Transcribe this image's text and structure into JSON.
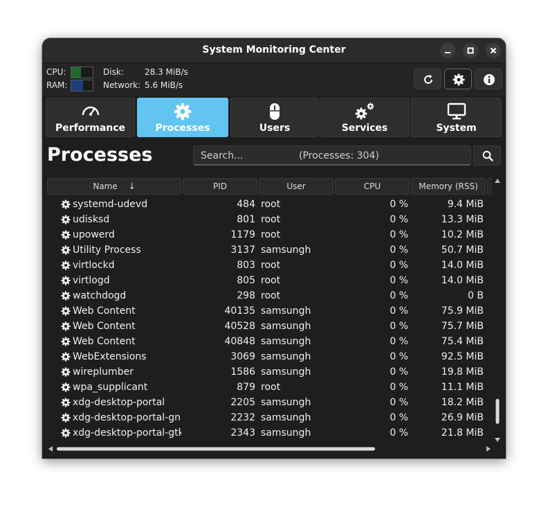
{
  "window": {
    "title": "System Monitoring Center"
  },
  "summary": {
    "cpu_label": "CPU:",
    "ram_label": "RAM:",
    "cpu_fraction": 0.45,
    "ram_fraction": 0.55,
    "disk_label": "Disk:",
    "disk_value": "28.3 MiB/s",
    "network_label": "Network:",
    "network_value": "5.6 MiB/s"
  },
  "colors": {
    "accent": "#62c4f0",
    "cpu_fill": "#1d6b2b",
    "ram_fill": "#1f3f7a"
  },
  "tabs": [
    {
      "label": "Performance",
      "icon": "speedometer-icon",
      "selected": false
    },
    {
      "label": "Processes",
      "icon": "gear-icon",
      "selected": true
    },
    {
      "label": "Users",
      "icon": "mouse-icon",
      "selected": false
    },
    {
      "label": "Services",
      "icon": "gears-icon",
      "selected": false
    },
    {
      "label": "System",
      "icon": "monitor-icon",
      "selected": false
    }
  ],
  "page": {
    "heading": "Processes"
  },
  "search": {
    "placeholder": "Search...",
    "count_text": "(Processes: 304)"
  },
  "table": {
    "columns": [
      "Name",
      "PID",
      "User",
      "CPU",
      "Memory (RSS)"
    ],
    "sort_indicator": "↓",
    "rows": [
      {
        "name": "systemd-udevd",
        "pid": "484",
        "user": "root",
        "cpu": "0 %",
        "mem": "9.4 MiB"
      },
      {
        "name": "udisksd",
        "pid": "801",
        "user": "root",
        "cpu": "0 %",
        "mem": "13.3 MiB"
      },
      {
        "name": "upowerd",
        "pid": "1179",
        "user": "root",
        "cpu": "0 %",
        "mem": "10.2 MiB"
      },
      {
        "name": "Utility Process",
        "pid": "3137",
        "user": "samsungh",
        "cpu": "0 %",
        "mem": "50.7 MiB"
      },
      {
        "name": "virtlockd",
        "pid": "803",
        "user": "root",
        "cpu": "0 %",
        "mem": "14.0 MiB"
      },
      {
        "name": "virtlogd",
        "pid": "805",
        "user": "root",
        "cpu": "0 %",
        "mem": "14.0 MiB"
      },
      {
        "name": "watchdogd",
        "pid": "298",
        "user": "root",
        "cpu": "0 %",
        "mem": "0 B"
      },
      {
        "name": "Web Content",
        "pid": "40135",
        "user": "samsungh",
        "cpu": "0 %",
        "mem": "75.9 MiB"
      },
      {
        "name": "Web Content",
        "pid": "40528",
        "user": "samsungh",
        "cpu": "0 %",
        "mem": "75.7 MiB"
      },
      {
        "name": "Web Content",
        "pid": "40848",
        "user": "samsungh",
        "cpu": "0 %",
        "mem": "75.4 MiB"
      },
      {
        "name": "WebExtensions",
        "pid": "3069",
        "user": "samsungh",
        "cpu": "0 %",
        "mem": "92.5 MiB"
      },
      {
        "name": "wireplumber",
        "pid": "1586",
        "user": "samsungh",
        "cpu": "0 %",
        "mem": "19.8 MiB"
      },
      {
        "name": "wpa_supplicant",
        "pid": "879",
        "user": "root",
        "cpu": "0 %",
        "mem": "11.1 MiB"
      },
      {
        "name": "xdg-desktop-portal",
        "pid": "2205",
        "user": "samsungh",
        "cpu": "0 %",
        "mem": "18.2 MiB"
      },
      {
        "name": "xdg-desktop-portal-gn",
        "pid": "2232",
        "user": "samsungh",
        "cpu": "0 %",
        "mem": "26.9 MiB"
      },
      {
        "name": "xdg-desktop-portal-gtk",
        "pid": "2343",
        "user": "samsungh",
        "cpu": "0 %",
        "mem": "21.8 MiB"
      }
    ]
  },
  "scroll": {
    "vertical_position": 0.95,
    "horizontal_position": 0.0
  }
}
